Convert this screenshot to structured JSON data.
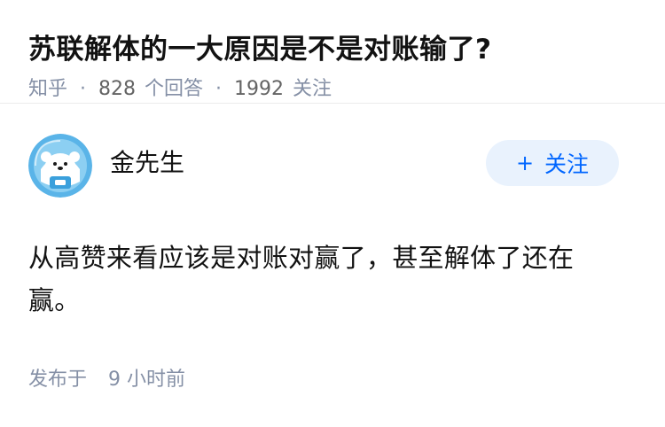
{
  "question": {
    "title": "苏联解体的一大原因是不是对账输了?",
    "source": "知乎",
    "separator": "·",
    "answer_count": "828",
    "answer_label": "个回答",
    "follower_count": "1992",
    "follower_label": "关注"
  },
  "answer": {
    "author": {
      "name": "金先生",
      "avatar_icon": "astronaut-bear-avatar"
    },
    "follow_button": {
      "plus": "+",
      "label": "关注"
    },
    "content": "从高赞来看应该是对账对赢了，甚至解体了还在赢。",
    "time_prefix": "发布于",
    "time_value": "9 小时前"
  },
  "colors": {
    "title": "#121212",
    "meta": "#8590a6",
    "follow_bg": "#e9f2fd",
    "follow_text": "#0066ff",
    "avatar_bg": "#5ab4e8"
  }
}
